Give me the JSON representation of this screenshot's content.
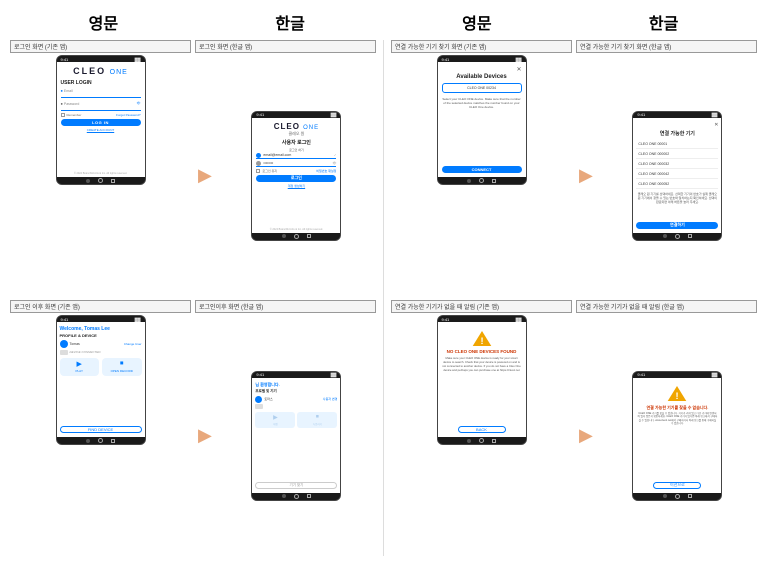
{
  "headers": {
    "left_en": "영문",
    "left_ko": "한글",
    "right_en": "영문",
    "right_ko": "한글"
  },
  "sections": {
    "login_en_label": "로그인 화면 (기존 앱)",
    "login_ko_label": "로그인 화면 (한글 앱)",
    "postlogin_en_label": "로그인 이후 화면 (기존 앱)",
    "postlogin_ko_label": "로그인이후 화면 (한글 앱)",
    "device_list_en_label": "연결 가능한 기기 찾기 화면 (기존 앱)",
    "device_list_ko_label": "연결 가능한 기기 찾기 화면 (한글 앱)",
    "no_device_en_label": "연결 가능한 기기가 없을 때 알림 (기존 앱)",
    "no_device_ko_label": "연결 가능한 기기가 없을 때 알림 (한글 앱)"
  },
  "en_login": {
    "logo": "CLEO ONE",
    "title": "USER LOGIN",
    "email_label": "Email",
    "password_label": "Password",
    "remember_label": "Remember",
    "forgot_label": "Forgot Password?",
    "login_btn": "LOG IN",
    "create_btn": "CREATE ACCOUNT",
    "footer": "© 2024 Brainchild Arts & Inc. All rights reserved."
  },
  "ko_login": {
    "logo": "CLEO ONE",
    "logo_sub": "클레오 원",
    "title": "사용자 로그인",
    "subtitle": "로그인 하기",
    "email_label": "이메일",
    "email_placeholder": "email@email.com",
    "password_label": "비밀번호",
    "remember_label": "로그인 유지",
    "forgot_label": "비밀번호 재설정",
    "login_btn": "로그인",
    "register_link": "계정 생성하기",
    "footer": "© 2024 Brainchild Arts & Inc. All rights reserved."
  },
  "en_postlogin": {
    "welcome": "Welcome, Tomas Lee",
    "section": "PROFILE & DEVICE",
    "user_name": "Tomas",
    "change_user": "Change User",
    "device_name": "DEVICE CONNECTED",
    "play_label": "PLAY",
    "record_label": "OPEN RECORD",
    "find_device": "FIND DEVICE"
  },
  "ko_postlogin": {
    "welcome": "님 환영합니다.",
    "section": "프로필 및 기기",
    "user_name": "토마스",
    "change_user": "사용자 변경",
    "play_label": "재생",
    "record_label": "녹음하기",
    "find_device": "기기 찾기"
  },
  "en_device_list": {
    "title": "Available Devices",
    "device1": "CLEO ONE 00234",
    "description": "Select your CLEO ONE device. Make sure that the number of the selected device matches the number found on your CLEO One device.",
    "connect_btn": "CONNECT"
  },
  "ko_device_list": {
    "close": "✕",
    "title": "연결 가능한 기기",
    "device1": "CLEO ONE 00001",
    "device2": "CLEO ONE 000002",
    "device3": "CLEO ONE 000032",
    "device4": "CLEO ONE 000042",
    "device5": "CLEO ONE 000052",
    "description": "클레오 원 기기를 선택하세요. 선택한 기기의 번호가 실제 클레오 원 기기에서 찾을 수 있는 번호와 일치하는지 확인하세요. 선택이 완료되면 아래 버튼을 눌러 주세요.",
    "connect_btn": "연결하기"
  },
  "en_no_device": {
    "warning": "!",
    "title": "NO CLEO ONE DEVICES FOUND",
    "description": "Make sure your CLEO ONE device is ready for your smart device to search. Check that your device is powered on and is not connected to another device. If you do not have a Cleo One device and perhaps you can purchase one at https://cleo1.net",
    "back_btn": "BACK"
  },
  "ko_no_device": {
    "warning": "!",
    "title": "연결 가능한 기기를 찾을 수 없습니다.",
    "description": "CLEO ONE 기기를 찾을 수 없습니다. 기기가 켜져 있고 다른 기기에 연결되어 있지 않은지 확인하세요. CLEO ONE 기기가 없다면 아래 링크에서 구매하실 수 있습니다. www.cleo1.net에서 구매하거나 아래 링크를 통해 구매하실 수 있습니다.",
    "back_btn": "이전으로"
  },
  "colors": {
    "blue": "#007bff",
    "orange_arrow": "#e8a87c",
    "warning_yellow": "#f0a500",
    "warning_red": "#cc3300"
  }
}
